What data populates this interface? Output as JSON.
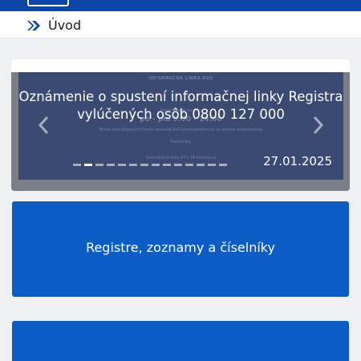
{
  "breadcrumb": {
    "current": "Úvod"
  },
  "carousel": {
    "slide": {
      "title_line1": "Oznámenie o spustení informačnej linky Registra",
      "title_line2": "vylúčených osôb 0800 127 000",
      "date": "27.01.2025",
      "background_text": [
        "INFORMAČNÁ LINKA RVO",
        "Prevádzkové hodiny:",
        "po - pia 9:00 - 14:00",
        "Mimo prevádzkových hodín posielať RVO korešpondenciu na adrese zodpovednej",
        "Poznámka:",
        "Konzultácia linky 871 18 bratislava"
      ]
    },
    "indicator_count": 14,
    "active_index": 1
  },
  "tiles": [
    {
      "label": "Registre, zoznamy a číselníky"
    },
    {
      "label": ""
    }
  ],
  "colors": {
    "header_blue": "#0b47a8",
    "tile_blue": "#0b5cc4",
    "slide_navy": "#3b4a72",
    "page_bg": "#eef0f3"
  },
  "icons": [
    "menu-logo-icon",
    "double-chevron-right-icon",
    "chevron-left-icon",
    "chevron-right-icon"
  ]
}
